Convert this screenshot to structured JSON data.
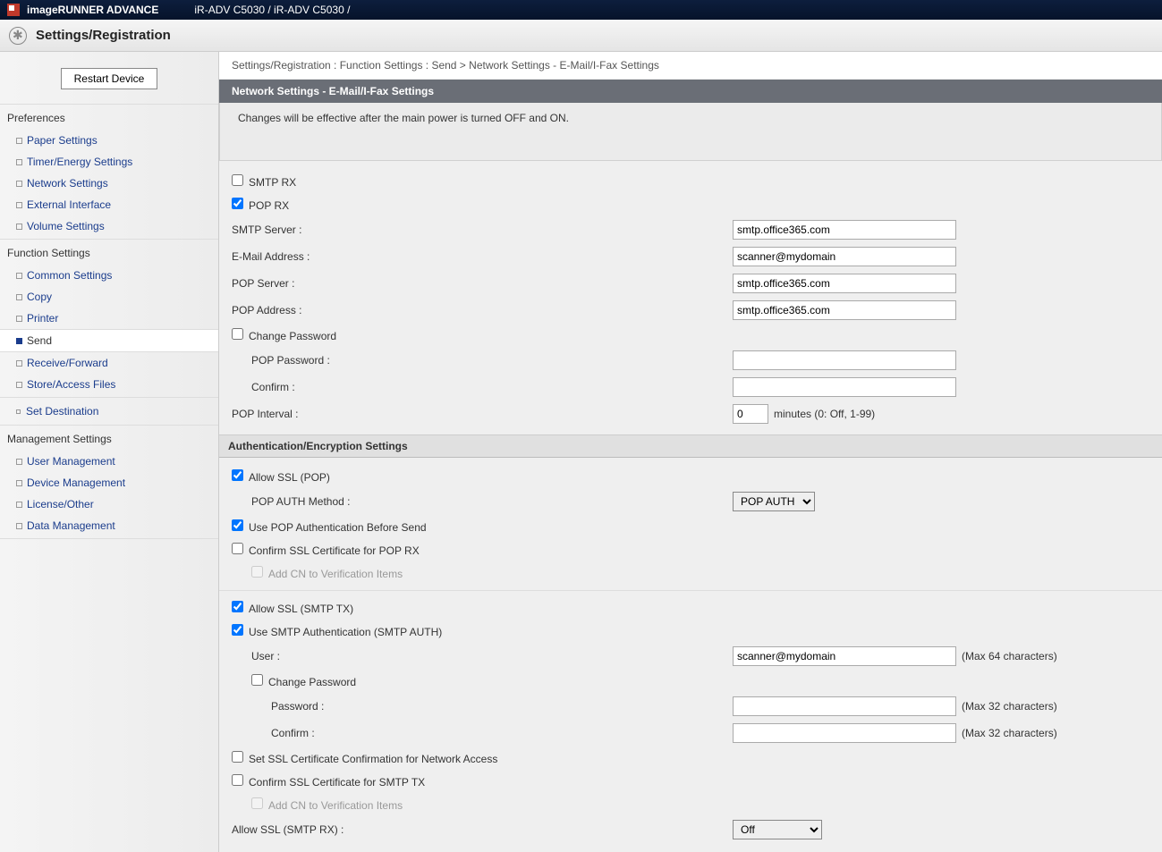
{
  "topbar": {
    "brand": "imageRUNNER ADVANCE",
    "model": "iR-ADV C5030 / iR-ADV C5030 /"
  },
  "header": {
    "title": "Settings/Registration"
  },
  "sidebar": {
    "restart_label": "Restart Device",
    "sections": {
      "preferences": "Preferences",
      "function_settings": "Function Settings",
      "set_destination": "Set Destination",
      "management_settings": "Management Settings"
    },
    "prefs_items": [
      "Paper Settings",
      "Timer/Energy Settings",
      "Network Settings",
      "External Interface",
      "Volume Settings"
    ],
    "func_items": [
      "Common Settings",
      "Copy",
      "Printer",
      "Send",
      "Receive/Forward",
      "Store/Access Files"
    ],
    "mgmt_items": [
      "User Management",
      "Device Management",
      "License/Other",
      "Data Management"
    ]
  },
  "breadcrumb": "Settings/Registration : Function Settings : Send > Network Settings - E-Mail/I-Fax Settings",
  "panel_title": "Network Settings - E-Mail/I-Fax Settings",
  "notice": "Changes will be effective after the main power is turned OFF and ON.",
  "form": {
    "smtp_rx_label": "SMTP RX",
    "pop_rx_label": "POP RX",
    "smtp_server_label": "SMTP Server :",
    "smtp_server_value": "smtp.office365.com",
    "email_addr_label": "E-Mail Address :",
    "email_addr_value": "scanner@mydomain",
    "pop_server_label": "POP Server :",
    "pop_server_value": "smtp.office365.com",
    "pop_addr_label": "POP Address :",
    "pop_addr_value": "smtp.office365.com",
    "change_pw_label": "Change Password",
    "pop_pw_label": "POP Password :",
    "confirm_label": "Confirm :",
    "pop_interval_label": "POP Interval :",
    "pop_interval_value": "0",
    "pop_interval_hint": "minutes (0: Off, 1-99)",
    "auth_header": "Authentication/Encryption Settings",
    "allow_ssl_pop_label": "Allow SSL (POP)",
    "pop_auth_method_label": "POP AUTH Method :",
    "pop_auth_method_value": "POP AUTH",
    "use_pop_before_label": "Use POP Authentication Before Send",
    "confirm_ssl_pop_label": "Confirm SSL Certificate for POP RX",
    "add_cn_label": "Add CN to Verification Items",
    "allow_ssl_smtp_tx_label": "Allow SSL (SMTP TX)",
    "use_smtp_auth_label": "Use SMTP Authentication (SMTP AUTH)",
    "user_label": "User :",
    "user_value": "scanner@mydomain",
    "user_hint": "(Max 64 characters)",
    "change_pw2_label": "Change Password",
    "password_label": "Password :",
    "password_hint": "(Max 32 characters)",
    "confirm2_label": "Confirm :",
    "confirm2_hint": "(Max 32 characters)",
    "set_ssl_cert_net_label": "Set SSL Certificate Confirmation for Network Access",
    "confirm_ssl_smtp_label": "Confirm SSL Certificate for SMTP TX",
    "add_cn2_label": "Add CN to Verification Items",
    "allow_ssl_smtp_rx_label": "Allow SSL (SMTP RX) :",
    "allow_ssl_smtp_rx_value": "Off"
  }
}
